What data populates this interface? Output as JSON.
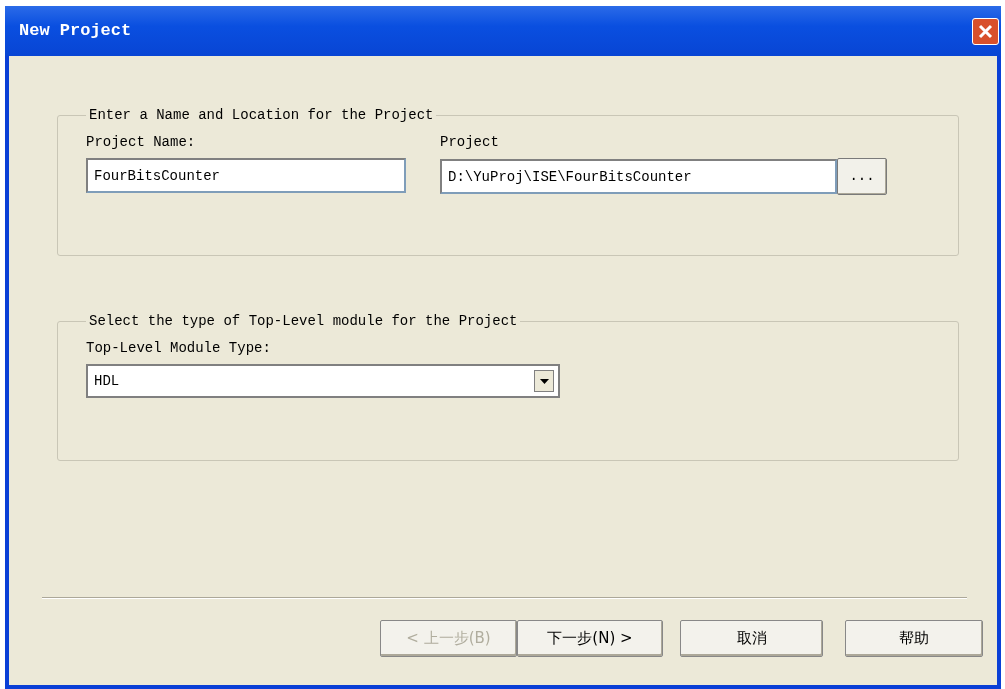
{
  "window": {
    "title": "New Project"
  },
  "name_location_group": {
    "legend": "Enter a Name and Location for the Project",
    "fields": [
      {
        "label": "Project Name:",
        "value": "FourBitsCounter"
      },
      {
        "label": "Project",
        "value": "D:\\YuProj\\ISE\\FourBitsCounter"
      }
    ],
    "browse_button": "..."
  },
  "module_group": {
    "legend": "Select the type of Top-Level module for the Project",
    "label": "Top-Level Module Type:",
    "value": "HDL"
  },
  "buttons": [
    {
      "label": "< 上一步(B)",
      "disabled": true
    },
    {
      "label": "下一步(N) >",
      "disabled": false
    },
    {
      "label": "取消",
      "disabled": false
    },
    {
      "label": "帮助",
      "disabled": false
    }
  ]
}
